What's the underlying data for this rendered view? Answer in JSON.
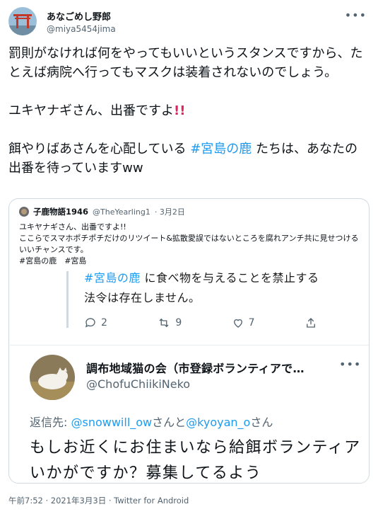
{
  "author": {
    "display_name": "あなごめし野郎",
    "handle": "@miya5454jima"
  },
  "more_label": "•••",
  "tweet": {
    "p1": "罰則がなければ何をやってもいいというスタンスですから、たとえば病院へ行ってもマスクは装着されないのでしょう。",
    "p2_text": "ユキヤナギさん、出番ですよ",
    "p2_emoji": "!!",
    "p3_before": "餌やりばあさんを心配している ",
    "p3_hashtag": "#宮島の鹿",
    "p3_after": " たちは、あなたの出番を待っていますww"
  },
  "quote": {
    "name": "子鹿物語1946",
    "handle": "@TheYearling1",
    "date": "· 3月2日",
    "line1": "ユキヤナギさん、出番ですよ!!",
    "line2": "ここらでスマホポチポチだけのリツイート&拡散愛誤ではないところを腐れアンチ共に見せつけるいいチャンスです。",
    "line3": "#宮島の鹿　#宮島"
  },
  "screenshot": {
    "partial_hashtag": "#宮島の鹿",
    "partial_rest": " に食べ物を与えることを禁止する",
    "law_line": "法令は存在しません。",
    "replies": "2",
    "retweets": "9",
    "likes": "7",
    "reply_name": "調布地域猫の会（市登録ボランティアで…",
    "reply_handle": "@ChofuChiikiNeko",
    "reply_to_prefix": "返信先: ",
    "reply_to_mention1": "@snowwill_ow",
    "reply_to_mid": "さんと",
    "reply_to_mention2": "@kyoyan_o",
    "reply_to_suffix": "さん",
    "reply_body": "もしお近くにお住まいなら給餌ボランティアいかがですか？募集してるよう"
  },
  "footer": "午前7:52 · 2021年3月3日 · Twitter for Android",
  "colors": {
    "link": "#1d9bf0",
    "muted": "#536471",
    "border": "#cfd9de",
    "emoji_red": "#e0245e"
  }
}
